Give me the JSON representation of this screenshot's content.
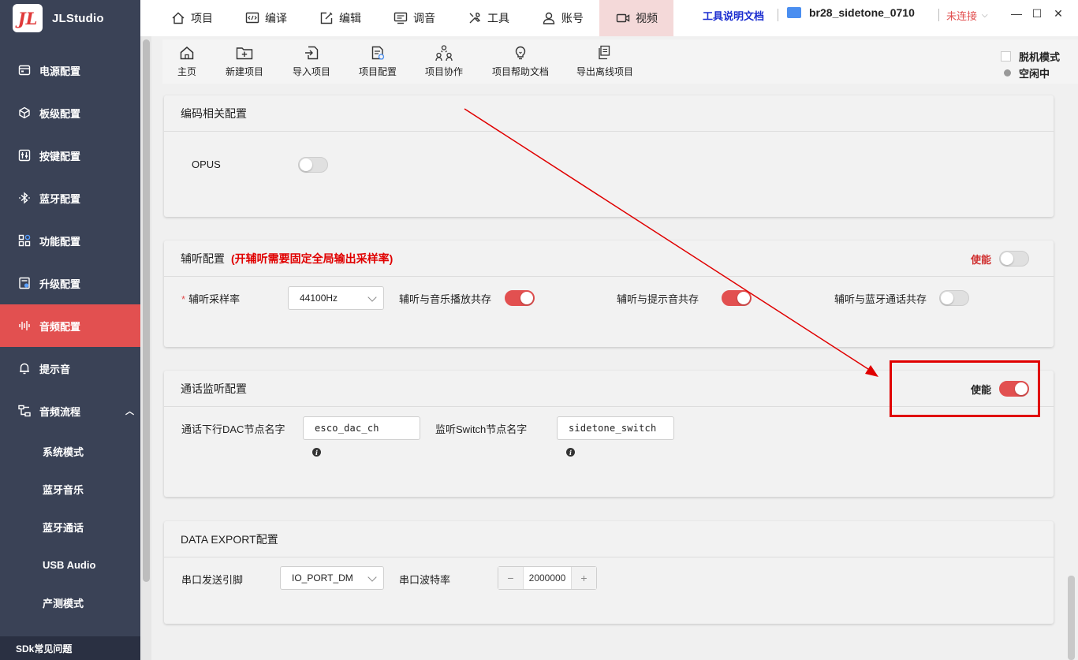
{
  "app": {
    "logo_text": "JL",
    "title": "JLStudio"
  },
  "sidebar": {
    "items": [
      {
        "label": "电源配置",
        "icon": "power-config-icon"
      },
      {
        "label": "板级配置",
        "icon": "board-config-icon"
      },
      {
        "label": "按键配置",
        "icon": "key-config-icon"
      },
      {
        "label": "蓝牙配置",
        "icon": "bluetooth-icon"
      },
      {
        "label": "功能配置",
        "icon": "function-config-icon"
      },
      {
        "label": "升级配置",
        "icon": "upgrade-config-icon"
      },
      {
        "label": "音频配置",
        "icon": "audio-config-icon",
        "active": true
      },
      {
        "label": "提示音",
        "icon": "bell-icon"
      },
      {
        "label": "音频流程",
        "icon": "flow-icon",
        "expanded": true
      }
    ],
    "sub_items": [
      "系统模式",
      "蓝牙音乐",
      "蓝牙通话",
      "USB Audio",
      "产测模式"
    ],
    "footer": "SDk常见问题"
  },
  "topbar": {
    "tabs": [
      {
        "label": "项目",
        "icon": "home-icon"
      },
      {
        "label": "编译",
        "icon": "code-icon"
      },
      {
        "label": "编辑",
        "icon": "edit-icon"
      },
      {
        "label": "调音",
        "icon": "tuning-icon"
      },
      {
        "label": "工具",
        "icon": "tools-icon"
      },
      {
        "label": "账号",
        "icon": "user-icon"
      },
      {
        "label": "视频",
        "icon": "video-icon",
        "active": true
      }
    ],
    "doc_link": "工具说明文档",
    "project_name": "br28_sidetone_0710",
    "connection": "未连接"
  },
  "toolbar": {
    "buttons": [
      {
        "label": "主页",
        "icon": "home-icon"
      },
      {
        "label": "新建项目",
        "icon": "new-folder-icon"
      },
      {
        "label": "导入项目",
        "icon": "import-icon"
      },
      {
        "label": "项目配置",
        "icon": "project-config-icon"
      },
      {
        "label": "项目协作",
        "icon": "collaboration-icon"
      },
      {
        "label": "项目帮助文档",
        "icon": "lightbulb-icon"
      },
      {
        "label": "导出离线项目",
        "icon": "export-icon"
      }
    ],
    "offline_mode": "脱机模式",
    "status": "空闲中"
  },
  "panels": {
    "codec": {
      "title": "编码相关配置",
      "opus_label": "OPUS",
      "opus_on": false
    },
    "aux_listen": {
      "title": "辅听配置",
      "warning": "(开辅听需要固定全局输出采样率)",
      "enable_label": "使能",
      "enabled": false,
      "sample_rate_label": "辅听采样率",
      "sample_rate_value": "44100Hz",
      "music_coexist_label": "辅听与音乐播放共存",
      "music_coexist_on": true,
      "tone_coexist_label": "辅听与提示音共存",
      "tone_coexist_on": true,
      "bt_call_coexist_label": "辅听与蓝牙通话共存",
      "bt_call_coexist_on": false
    },
    "call_monitor": {
      "title": "通话监听配置",
      "enable_label": "使能",
      "enabled": true,
      "dac_node_label": "通话下行DAC节点名字",
      "dac_node_value": "esco_dac_ch",
      "switch_node_label": "监听Switch节点名字",
      "switch_node_value": "sidetone_switch"
    },
    "data_export": {
      "title": "DATA EXPORT配置",
      "tx_pin_label": "串口发送引脚",
      "tx_pin_value": "IO_PORT_DM",
      "baud_label": "串口波特率",
      "baud_value": "2000000",
      "minus": "−",
      "plus": "+"
    }
  },
  "annotation": {
    "color": "#e00000"
  }
}
